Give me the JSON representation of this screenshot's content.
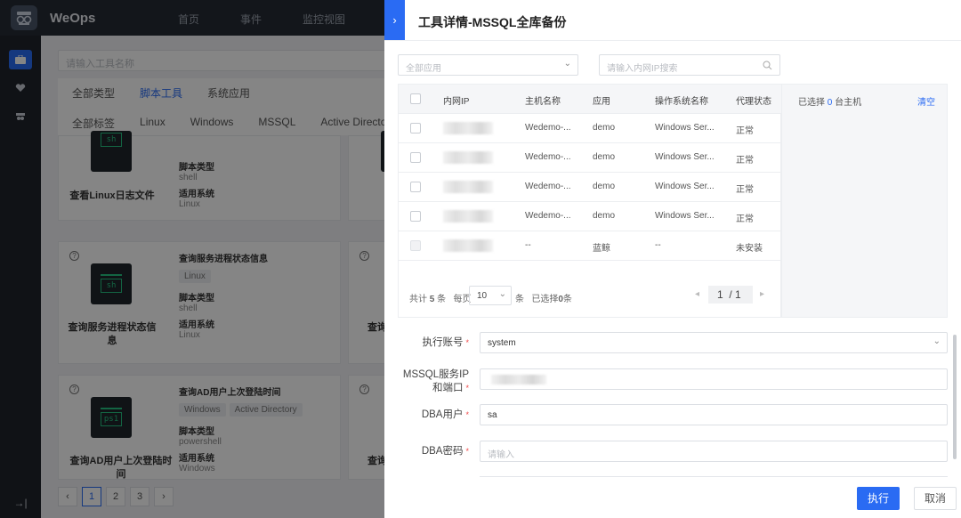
{
  "app": {
    "brand": "WeOps",
    "nav": [
      "首页",
      "事件",
      "监控视图"
    ]
  },
  "tools_page": {
    "search_placeholder": "请输入工具名称",
    "type_filters": [
      "全部类型",
      "脚本工具",
      "系统应用"
    ],
    "tag_filters": [
      "全部标签",
      "Linux",
      "Windows",
      "MSSQL",
      "Active Directo"
    ],
    "labels": {
      "script_type": "脚本类型",
      "system": "适用系统"
    },
    "cards": [
      {
        "title": "查看Linux日志文件",
        "script": "sh",
        "script_type": "shell",
        "system": "Linux",
        "tags": []
      },
      {
        "title": "查询服务进程状态信息",
        "name": "查询服务进程状态信息",
        "script": "sh",
        "script_type": "shell",
        "system": "Linux",
        "tags": [
          "Linux"
        ]
      },
      {
        "title": "查询AD用户上次登陆时间",
        "name": "查询AD用户上次登陆时间",
        "script": "ps1",
        "script_type": "powershell",
        "system": "Windows",
        "tags": [
          "Windows",
          "Active Directory"
        ]
      }
    ],
    "right_titles": [
      "查询",
      "查询"
    ],
    "pages": [
      "1",
      "2",
      "3"
    ]
  },
  "drawer": {
    "title": "工具详情-MSSQL全库备份",
    "app_select": "全部应用",
    "ip_search_placeholder": "请输入内网IP搜索",
    "columns": [
      "内网IP",
      "主机名称",
      "应用",
      "操作系统名称",
      "代理状态"
    ],
    "rows": [
      {
        "host": "Wedemo-...",
        "app": "demo",
        "os": "Windows Ser...",
        "status": "正常"
      },
      {
        "host": "Wedemo-...",
        "app": "demo",
        "os": "Windows Ser...",
        "status": "正常"
      },
      {
        "host": "Wedemo-...",
        "app": "demo",
        "os": "Windows Ser...",
        "status": "正常"
      },
      {
        "host": "Wedemo-...",
        "app": "demo",
        "os": "Windows Ser...",
        "status": "正常"
      },
      {
        "host": "--",
        "app": "蓝鲸",
        "os": "--",
        "status": "未安装"
      }
    ],
    "footer": {
      "total_prefix": "共计",
      "total": "5",
      "total_suffix": "条",
      "per_page_label": "每页",
      "per_page": "10",
      "per_page_unit": "条",
      "selected_prefix": "已选择",
      "selected": "0",
      "selected_suffix": "条",
      "page": "1",
      "page_total": "/ 1"
    },
    "selected_panel": {
      "prefix": "已选择",
      "count": "0",
      "suffix": "台主机",
      "clear": "清空"
    },
    "form": {
      "account_label": "执行账号",
      "account_value": "system",
      "mssql_label": "MSSQL服务IP和端口",
      "mssql_label_line1": "MSSQL服务IP",
      "mssql_label_line2": "和端口",
      "dba_user_label": "DBA用户",
      "dba_user_value": "sa",
      "dba_pass_label": "DBA密码",
      "dba_pass_placeholder": "请输入"
    },
    "buttons": {
      "run": "执行",
      "cancel": "取消"
    }
  }
}
